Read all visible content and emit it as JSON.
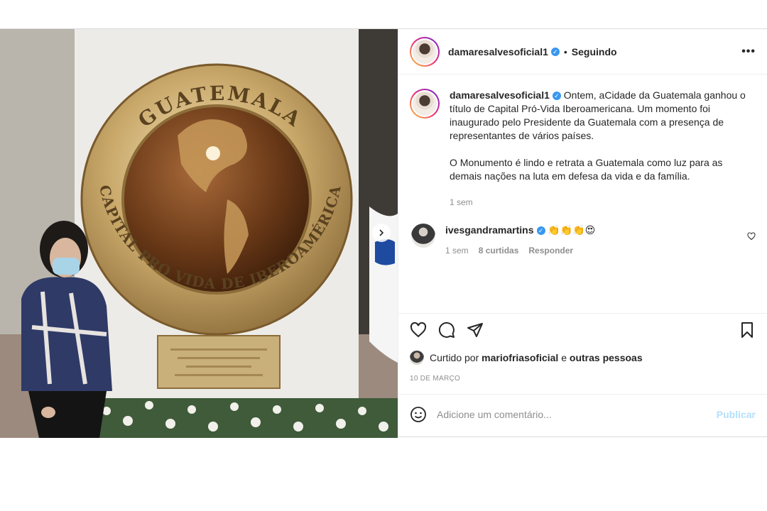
{
  "post": {
    "username": "damaresalvesoficial1",
    "follow_status": "Seguindo",
    "more_label": "•••"
  },
  "caption": {
    "username": "damaresalvesoficial1",
    "paragraph1": "Ontem, aCidade da Guatemala ganhou o título de Capital Pró-Vida Iberoamericana. Um momento foi inaugurado pelo Presidente da Guatemala com a presença de representantes de vários países.",
    "paragraph2": "O Monumento é lindo e retrata a Guatemala como luz para as demais nações na luta em defesa da vida e da família.",
    "time": "1 sem"
  },
  "comment": {
    "username": "ivesgandramartins",
    "text": "👏👏👏😍",
    "time": "1 sem",
    "likes": "8 curtidas",
    "reply": "Responder"
  },
  "likes": {
    "prefix": "Curtido por",
    "user": "mariofriasoficial",
    "connector": "e",
    "others": "outras pessoas"
  },
  "date": "10 DE MARÇO",
  "add_comment": {
    "placeholder": "Adicione um comentário...",
    "publish": "Publicar"
  },
  "photo": {
    "seal_top": "GUATEMALA",
    "seal_bottom": "CAPITAL PRO VIDA DE IBEROAMÉRICA"
  },
  "colors": {
    "accent": "#3897f0",
    "publish_disabled": "#b2dffc",
    "muted": "#8e8e8e"
  }
}
